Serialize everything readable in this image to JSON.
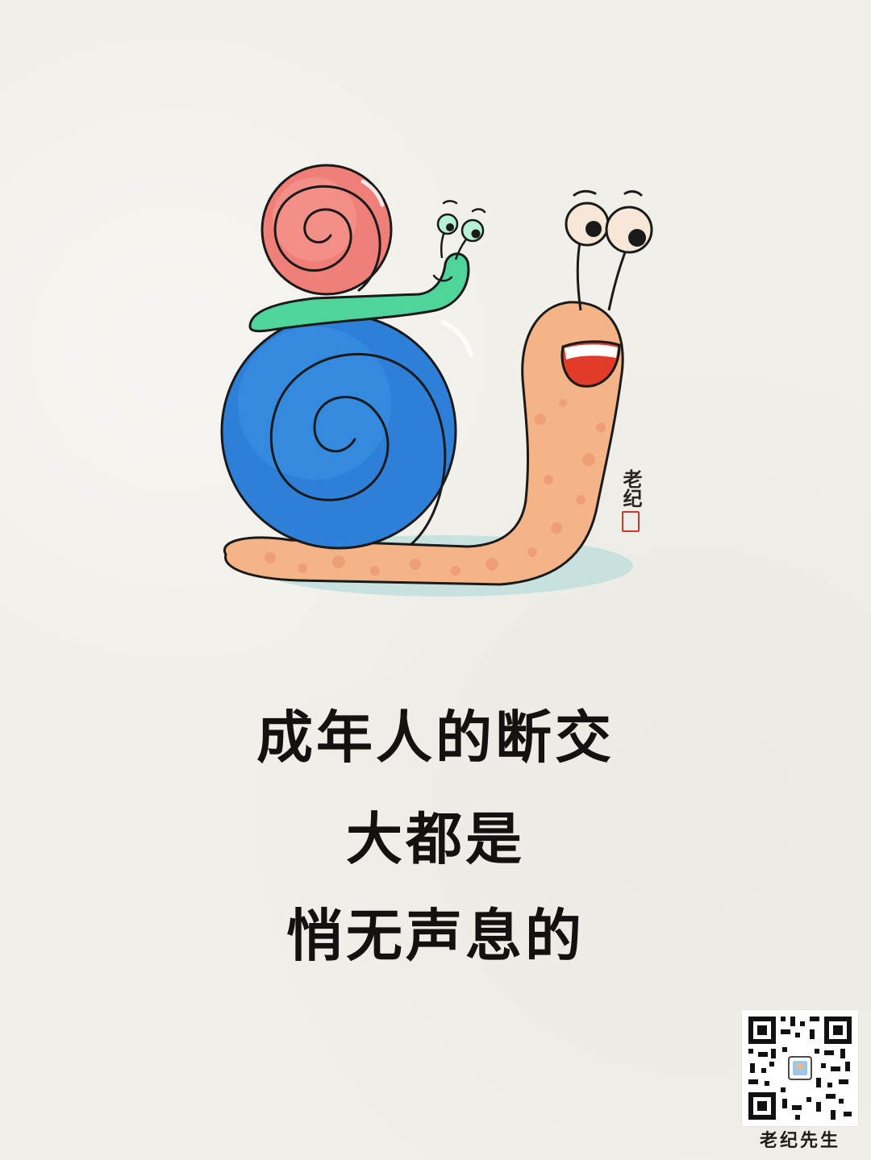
{
  "illustration": {
    "subject": "snail-carrying-small-snail",
    "colors": {
      "big_shell": "#2e7fd8",
      "big_shell_dark": "#1c5fb6",
      "body": "#f5b487",
      "small_shell": "#ef7f78",
      "small_body": "#4fd49a",
      "mouth": "#e23b2a",
      "shadow": "#b9dedb",
      "outline": "#1a1a1a"
    }
  },
  "signature": {
    "text": "老纪",
    "seal_color": "#c53a30"
  },
  "headline": {
    "line1": "成年人的断交",
    "line2": "大都是",
    "line3": "悄无声息的",
    "color": "#141210"
  },
  "qr": {
    "caption": "老纪先生"
  }
}
